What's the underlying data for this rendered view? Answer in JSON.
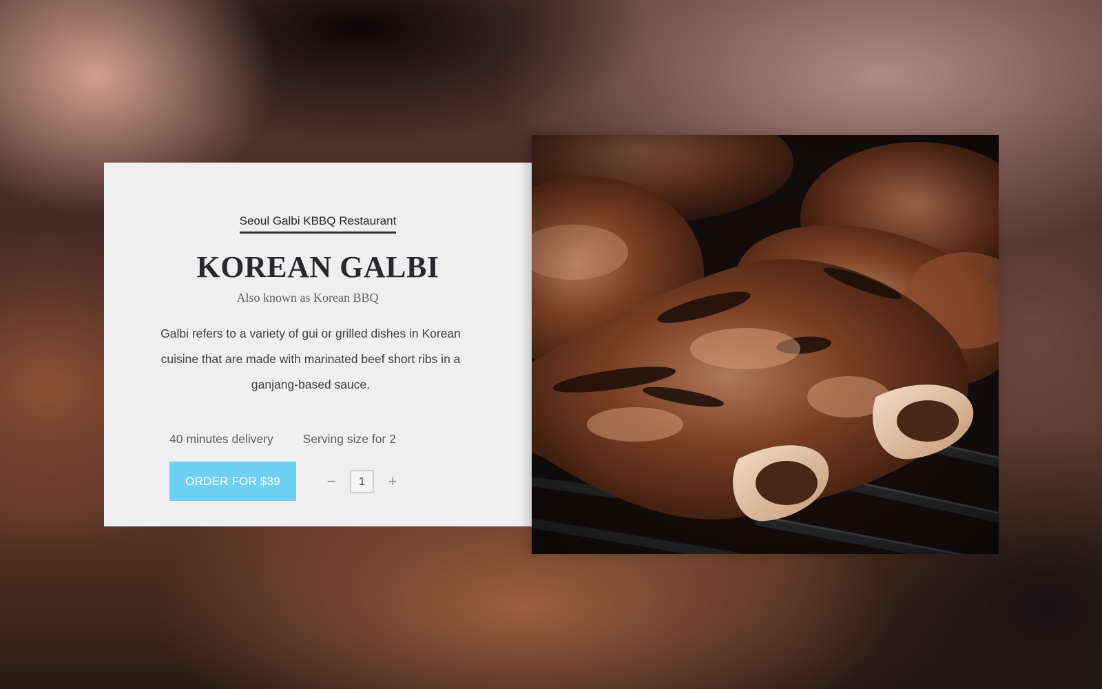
{
  "card": {
    "restaurant_name": "Seoul Galbi KBBQ Restaurant",
    "dish_title": "KOREAN GALBI",
    "subtitle": "Also known as Korean BBQ",
    "description": "Galbi refers to a variety of gui or grilled dishes in Korean cuisine that are made with marinated beef short ribs in a ganjang-based sauce.",
    "delivery_time": "40 minutes delivery",
    "serving_size": "Serving size for 2",
    "order_button_label": "ORDER FOR $39",
    "quantity": "1",
    "decrement_symbol": "−",
    "increment_symbol": "+"
  },
  "photo": {
    "alt": "Grilled Korean galbi short ribs on a grill"
  },
  "colors": {
    "accent": "#6fd0f6",
    "card_background": "#efefef",
    "title_text": "#26292d"
  }
}
